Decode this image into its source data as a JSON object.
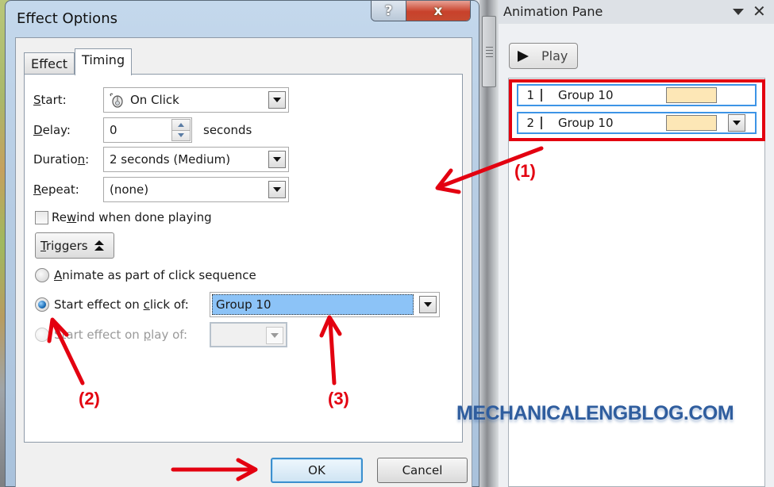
{
  "dialog": {
    "title": "Effect Options",
    "help_label": "?",
    "close_label": "x",
    "tabs": [
      {
        "label": "Effect",
        "active": false
      },
      {
        "label": "Timing",
        "active": true
      }
    ],
    "timing": {
      "start": {
        "label_u": "S",
        "label_rest": "tart:",
        "value": "On Click",
        "icon": "mouse-icon"
      },
      "delay": {
        "label_u": "D",
        "label_rest": "elay:",
        "value": "0",
        "unit": "seconds"
      },
      "duration": {
        "label_pre": "Duratio",
        "label_u": "n",
        "label_post": ":",
        "value": "2 seconds (Medium)"
      },
      "repeat": {
        "label_u": "R",
        "label_rest": "epeat:",
        "value": "(none)"
      },
      "rewind": {
        "label_pre": "Re",
        "label_u": "w",
        "label_post": "ind when done playing",
        "checked": false
      },
      "triggers_label_u": "T",
      "triggers_label_rest": "riggers",
      "radio_options": [
        {
          "label_pre": "",
          "label_u": "A",
          "label_post": "nimate as part of click sequence",
          "checked": false,
          "enabled": true
        },
        {
          "label_pre": "Start effect on ",
          "label_u": "c",
          "label_post": "lick of:",
          "checked": true,
          "enabled": true
        },
        {
          "label_pre": "Start effect on ",
          "label_u": "p",
          "label_post": "lay of:",
          "checked": false,
          "enabled": false
        }
      ],
      "click_of_value": "Group 10",
      "play_of_value": ""
    },
    "ok_label": "OK",
    "cancel_label": "Cancel"
  },
  "animation_pane": {
    "title": "Animation Pane",
    "play_label": "Play",
    "items": [
      {
        "number": "1",
        "name": "Group 10",
        "timeline_color": "#fde7b6"
      },
      {
        "number": "2",
        "name": "Group 10",
        "timeline_color": "#fde7b6"
      }
    ]
  },
  "annotations": {
    "step1": "(1)",
    "step2": "(2)",
    "step3": "(3)",
    "color": "#e30010"
  },
  "watermark": "MECHANICALENGBLOG.COM"
}
